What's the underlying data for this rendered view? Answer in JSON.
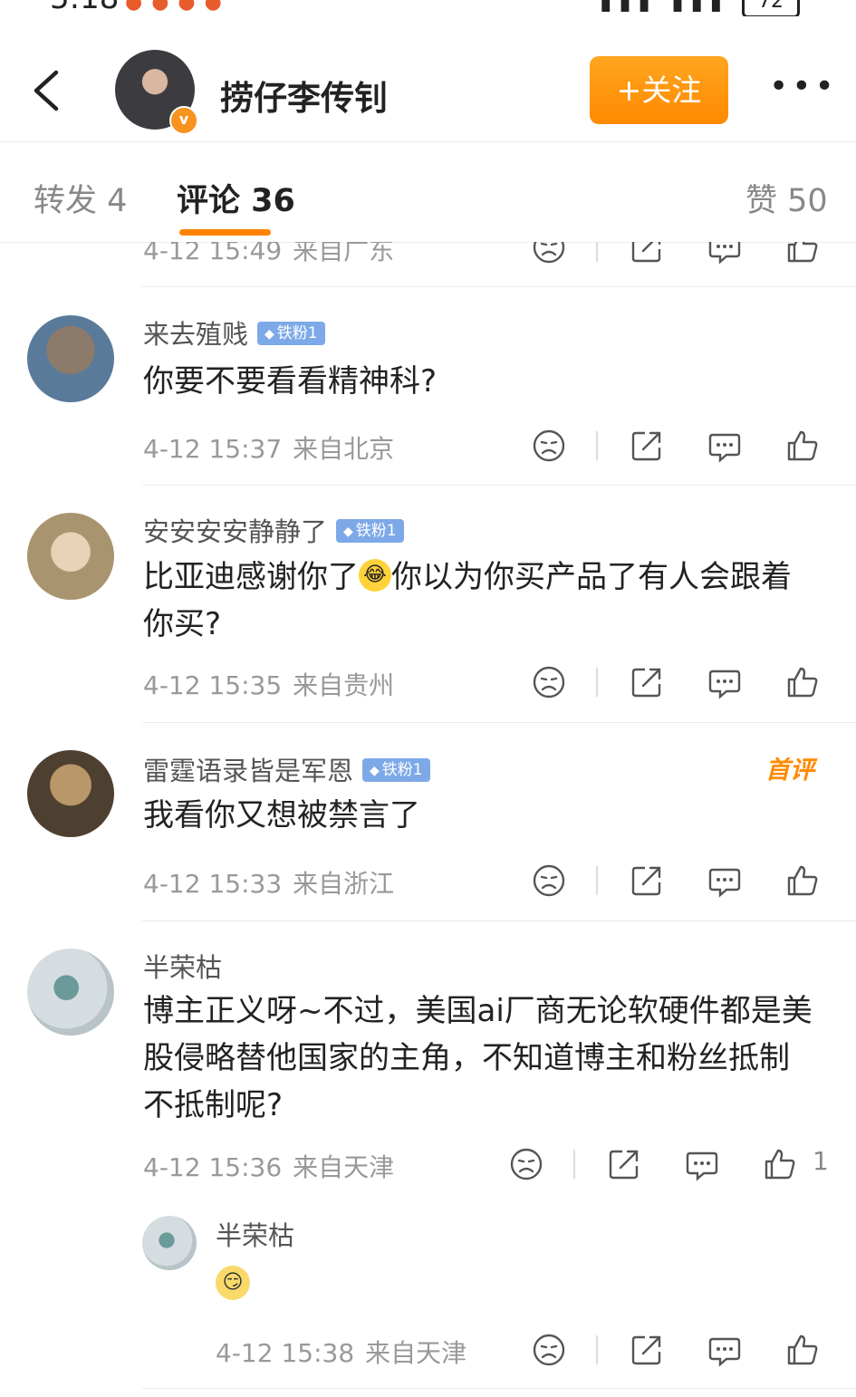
{
  "status_bar": {
    "time": "5:18",
    "battery": "72"
  },
  "header": {
    "author": "捞仔李传钊",
    "follow_label": "+关注"
  },
  "tabs": [
    {
      "label": "转发 4"
    },
    {
      "label": "评论 36"
    },
    {
      "label": "赞 50"
    }
  ],
  "partial_comment": {
    "time": "4-12 15:49",
    "location": "来自广东"
  },
  "comments": [
    {
      "user": "来去殖贱",
      "badge": "铁粉1",
      "text": "你要不要看看精神科?",
      "time": "4-12 15:37",
      "location": "来自北京"
    },
    {
      "user": "安安安安静静了",
      "badge": "铁粉1",
      "text_a": "比亚迪感谢你了",
      "text_b": "你以为你买产品了有人会跟着你买?",
      "time": "4-12 15:35",
      "location": "来自贵州"
    },
    {
      "user": "雷霆语录皆是军恩",
      "badge": "铁粉1",
      "first_label": "首评",
      "text": "我看你又想被禁言了",
      "time": "4-12 15:33",
      "location": "来自浙江"
    },
    {
      "user": "半荣枯",
      "text": "博主正义呀~不过，美国ai厂商无论软硬件都是美股侵略替他国家的主角，不知道博主和粉丝抵制不抵制呢?",
      "time": "4-12 15:36",
      "location": "来自天津",
      "likes": "1"
    }
  ],
  "reply": {
    "user": "半荣枯",
    "time": "4-12 15:38",
    "location": "来自天津"
  }
}
